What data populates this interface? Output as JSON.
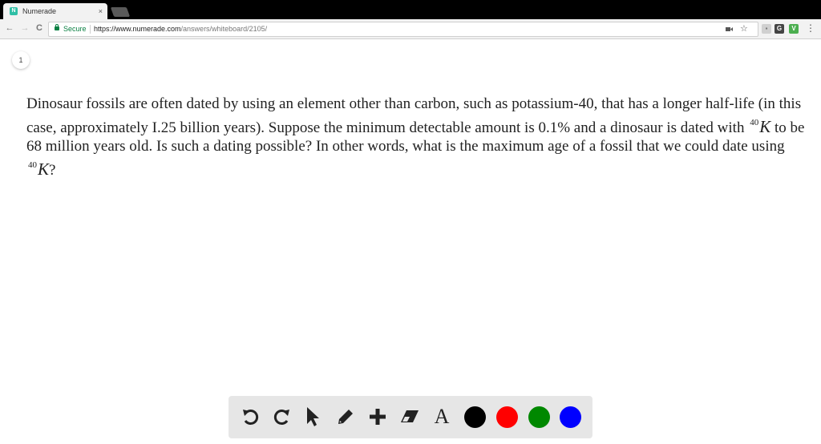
{
  "browser": {
    "tab": {
      "title": "Numerade",
      "favicon": "N",
      "close": "×"
    },
    "nav": {
      "back": "←",
      "forward": "→",
      "reload": "C"
    },
    "omnibox": {
      "secure_label": "Secure",
      "url_domain": "https://www.numerade.com",
      "url_path": "/answers/whiteboard/2105/"
    },
    "extensions": {
      "g": "G",
      "v": "V",
      "menu": "⋮"
    }
  },
  "page": {
    "number": "1",
    "question": {
      "part1": "Dinosaur fossils are often dated by using an element other than carbon, such as potassium-40, that has a longer half-life (in this case, approximately I.25 billion years). Suppose the minimum detectable amount is ",
      "percent": "0.1%",
      "part2": " and a dinosaur is dated with ",
      "iso_mass": "40",
      "iso_symbol": "K",
      "part3": " to be 68 million years old. Is such a dating possible? In other words, what is the maximum age of a fossil that we could date using ",
      "iso_mass2": "40",
      "iso_symbol2": "K",
      "part4": "?"
    }
  },
  "toolbar": {
    "tools": [
      "undo-icon",
      "redo-icon",
      "pointer-icon",
      "pencil-icon",
      "plus-icon",
      "eraser-icon",
      "text-icon"
    ],
    "text_tool_label": "A",
    "colors": [
      "#000000",
      "#ff0000",
      "#008800",
      "#0000ff"
    ]
  }
}
